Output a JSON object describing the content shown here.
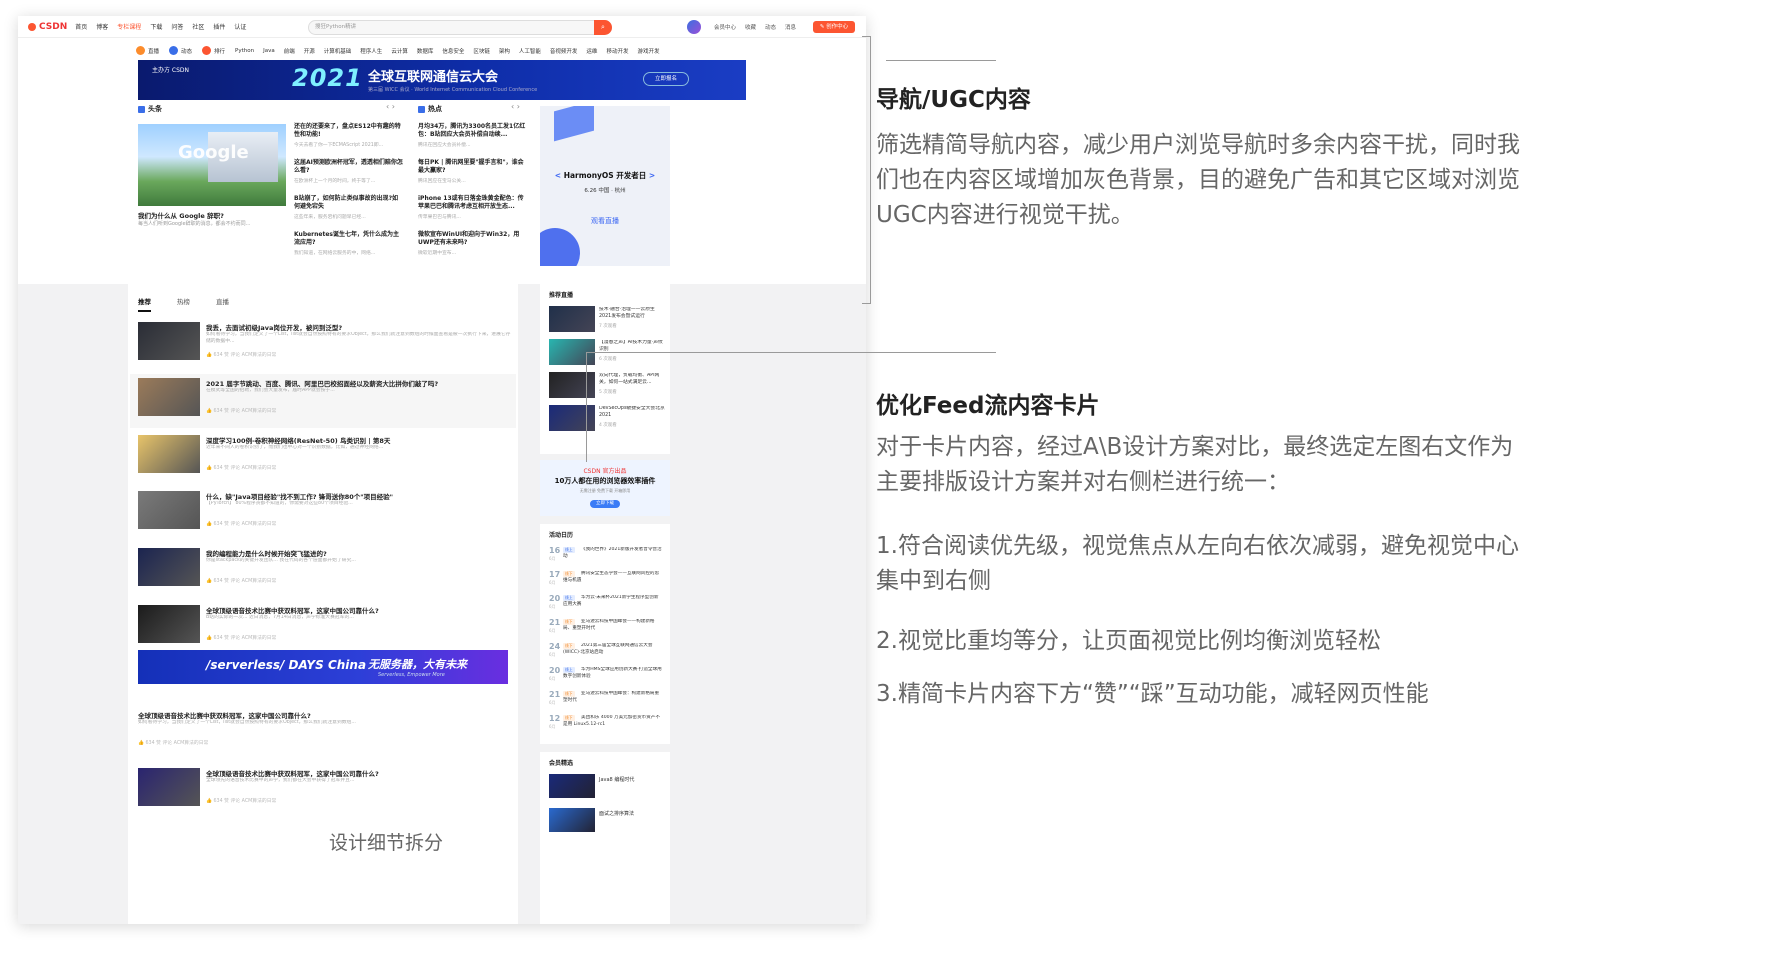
{
  "topbar": {
    "logo": "CSDN",
    "nav": [
      "首页",
      "博客",
      "专栏课程",
      "下载",
      "问答",
      "社区",
      "插件",
      "认证"
    ],
    "nav_active_index": 2,
    "search_placeholder": "搜狂Python精讲",
    "right_nav": [
      "会员中心",
      "收藏",
      "动态",
      "消息"
    ],
    "create_label": "创作中心"
  },
  "catbar": {
    "icons": [
      {
        "label": "直播",
        "color": "#fc8c2c"
      },
      {
        "label": "动态",
        "color": "#3a6ee8"
      },
      {
        "label": "排行",
        "color": "#fc5531"
      }
    ],
    "tags": [
      "Python",
      "Java",
      "前端",
      "开源",
      "计算机基础",
      "程序人生",
      "云计算",
      "数据库",
      "信息安全",
      "区块链",
      "架构",
      "人工智能",
      "音视频开发",
      "运维",
      "移动开发",
      "游戏开发"
    ]
  },
  "banner": {
    "logos": "主办方 CSDN",
    "year": "2021",
    "title": "全球互联网通信云大会",
    "subtitle": "第三届 WICC 会议 · World Internet Communication Cloud Conference",
    "button": "立即报名"
  },
  "headlines": {
    "title": "头条",
    "hero_title": "我们为什么从 Google 辞职?",
    "hero_sub": "每当人们听到Google辞职的消息，都会不约而同...",
    "items": [
      {
        "t": "还在的还要来了，盘点ES12中有趣的特性和功能!",
        "s": "今天去看了你一下ECMAScript 2021即..."
      },
      {
        "t": "这届AI预测欧洲杯冠军，透透相们赔你怎么看?",
        "s": "在欧洲杯上一个月的时间，终于等了..."
      },
      {
        "t": "B站崩了，如何防止类似事故的出现?如何避免宕失",
        "s": "这些年来，服务宕机问题早已经..."
      },
      {
        "t": "Kubernetes诞生七年，凭什么成为主流应用?",
        "s": "我们知道，在网络云服务的中，网络..."
      }
    ]
  },
  "hot": {
    "title": "热点",
    "items": [
      {
        "t": "月均34万，腾讯为3300名员工发1亿红包：B站回应大会员补偿自动续...",
        "s": "腾讯在回应大会员补偿..."
      },
      {
        "t": "每日PK | 腾讯网里要\"握手言和\"，谁会最大赢家?",
        "s": "腾讯回应在宝马公关..."
      },
      {
        "t": "iPhone 13或有日落金珠黄金配色：传苹果巴巴和腾讯考虑互相开放生态...",
        "s": "传苹果巴巴与腾讯..."
      },
      {
        "t": "微软宣布WinUI和迎向于Win32，用UWP还有未来吗?",
        "s": "微软近期中宣布..."
      }
    ]
  },
  "harmony": {
    "title_pre": "<",
    "title": " HarmonyOS 开发者日 ",
    "title_post": ">",
    "date": "6.26 中国 · 杭州",
    "watch": "观看直播"
  },
  "feed": {
    "tabs": [
      "推荐",
      "热榜",
      "直播"
    ],
    "active_tab": 0,
    "cards": [
      {
        "t": "我丢，去面试初级Java岗位开发，被问到泛型?",
        "s": "如何看待学习，当我们定义了一个List，list就会自然按照特有的要求Object，那么我们就注意到数组的时候面查看是被一次执行下来，进展它存储的数据中...",
        "m": "634 赞   评论   ACM算法的日常",
        "img": "#2a2d36",
        "hi": false
      },
      {
        "t": "2021 届字节跳动、百度、腾讯、阿里巴巴校招面经以及薪资大比拼你们敲了吗?",
        "s": "在模式等全国的招聘，我们会大量发布，届时APP就会按于...",
        "m": "634 赞   评论   ACM算法的日常",
        "img": "#9b7b5a",
        "hi": true
      },
      {
        "t": "深度学习100例-卷积神经网络(ResNet-50) 鸟类识别 | 第8天",
        "s": "近年来不同人的卷积识别了，而我们也中心对一个识别数据，比如，通过神经网络...",
        "m": "634 赞   评论   ACM算法的日常",
        "img": "#e8c46a",
        "hi": false
      },
      {
        "t": "什么，缺\"Java项目经验\"找不到工作? 锋哥送你80个\"项目经验\"",
        "s": "【PyTorch】 80%程序员都不知道的，你需要对这些80个项目经验...",
        "m": "634 赞   评论   ACM算法的日常",
        "img": "#7a7a7a",
        "hi": false
      },
      {
        "t": "我的编程能力是什么时候开始突飞猛进的?",
        "s": "你是stackpack的关键开发团队... 我在代码的各个层面都开始了研究...",
        "m": "634 赞   评论   ACM算法的日常",
        "img": "#1b2450",
        "hi": false
      },
      {
        "t": "全球顶级语音技术比赛中获双料冠军，这家中国公司靠什么?",
        "s": "B站的实际的一次... 近日消息，7月14日消息，声学标准大赛冠军的...",
        "m": "634 赞   评论   ACM算法的日常",
        "img": "#1b1b1b",
        "hi": false
      },
      {
        "t": "全球顶级语音技术比赛中获双料冠军，这家中国公司靠什么?",
        "s": "如何看待学习，当我们定义了一个List，list就会自然按照特有的要求Object，那么我们就注意到数组...",
        "m": "634 赞   评论   ACM算法的日常",
        "img": "",
        "hi": false
      },
      {
        "t": "全球顶级语音技术比赛中获双料冠军，这家中国公司靠什么?",
        "s": "全球领先的语音技术比赛中的声学，我们都在大会中获得了冠军并且...",
        "m": "634 赞   评论   ACM算法的日常",
        "img": "#2a2470",
        "hi": false
      }
    ],
    "ad": {
      "left": "/serverless/ DAYS China",
      "right": "无服务器，大有未来",
      "sub": "Serverless, Empower More"
    }
  },
  "right": {
    "live_title": "推荐直播",
    "lives": [
      {
        "t": "技术·融合·治理——云原生2021发布会暨试运行",
        "s": "7 次观看",
        "img": "#20304a"
      },
      {
        "t": "【漫春之声】AI技术力量·声纹识别",
        "s": "6 次观看",
        "img": "#28b6b0"
      },
      {
        "t": "双向代理，负载均衡、API网关，如何一站式满足云...",
        "s": "5 次观看",
        "img": "#222"
      },
      {
        "t": "DevSecOps敏捷安全大会北京2021",
        "s": "4 次观看",
        "img": "#1a2a7a"
      }
    ],
    "csdn_ad": {
      "brand": "CSDN 官方出品",
      "title": "10万人都在用的浏览器效率插件",
      "sub": "无需注册 免费下载 开箱即用",
      "btn": "立即下载"
    },
    "events_title": "活动日历",
    "events": [
      {
        "d": "16",
        "m": "6月",
        "tag": "线上",
        "t": "《我的世界》2021新版开发者普令营活动"
      },
      {
        "d": "17",
        "m": "6月",
        "tag": "线下",
        "t": "腾讯安全生态学会——互联网风控的思维与机遇"
      },
      {
        "d": "20",
        "m": "6月",
        "tag": "线上",
        "t": "华为云·未来杯2021新学生程序型创新应用大赛"
      },
      {
        "d": "21",
        "m": "6月",
        "tag": "线下",
        "t": "亚马逊云科技中国峰会——构建新格局、重塑开时代"
      },
      {
        "d": "24",
        "m": "6月",
        "tag": "线下",
        "t": "2021第三届全球互联网通信云大会(WICC)·北京站启动"
      },
      {
        "d": "20",
        "m": "6月",
        "tag": "线上",
        "t": "华为HMS全球应用创新大赛·打造全球用数字创新体验"
      },
      {
        "d": "21",
        "m": "6月",
        "tag": "线下",
        "t": "亚马逊云科技中国峰会：构建新格局重塑时代"
      },
      {
        "d": "12",
        "m": "6月",
        "tag": "线下",
        "t": "美团和乐 4000 万美元加密货币资产不是用 Linux5.12-rc1"
      }
    ],
    "member_title": "会员精选",
    "members": [
      {
        "t": "Java8 编程时代",
        "img": "#1a2a7a"
      },
      {
        "t": "面试之排序算法",
        "img": "#2a6ad0"
      }
    ]
  },
  "annotations": {
    "a1_title": "导航/UGC内容",
    "a1_text": "筛选精简导航内容，减少用户浏览导航时多余内容干扰，同时我们也在内容区域增加灰色背景，目的避免广告和其它区域对浏览UGC内容进行视觉干扰。",
    "a2_title": "优化Feed流内容卡片",
    "a2_text": "对于卡片内容，经过A\\B设计方案对比，最终选定左图右文作为主要排版设计方案并对右侧栏进行统一：",
    "a2_p1": "1.符合阅读优先级，视觉焦点从左向右依次减弱，避免视觉中心集中到右侧",
    "a2_p2": "2.视觉比重均等分，让页面视觉比例均衡浏览轻松",
    "a2_p3": "3.精简卡片内容下方“赞”“踩”互动功能，减轻网页性能",
    "caption": "设计细节拆分"
  },
  "colors": {
    "accent": "#fc5531",
    "blue": "#3a6ee8",
    "annot_text": "#666666",
    "annot_title": "#222222"
  }
}
